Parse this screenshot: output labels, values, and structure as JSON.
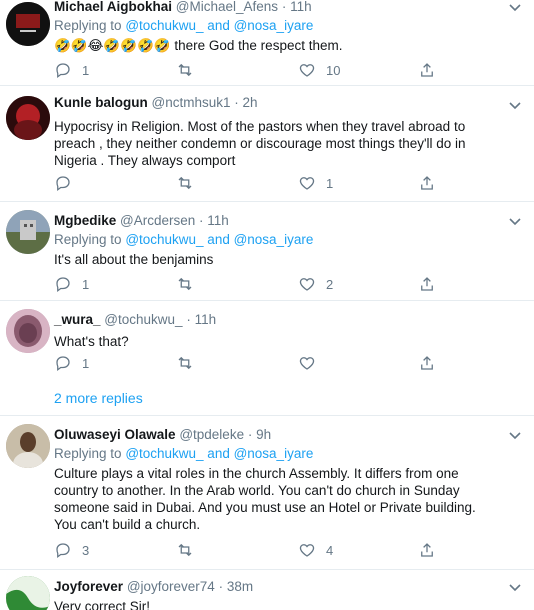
{
  "tweets": [
    {
      "name": "Michael Aigbokhai",
      "handle": "@Michael_Afens",
      "dot": "·",
      "time": "11h",
      "replying_to_prefix": "Replying to",
      "replying_to_users": "@tochukwu_ and @nosa_iyare",
      "text": "🤣🤣😂🤣🤣🤣🤣  there God the respect them.",
      "reply_count": "1",
      "like_count": "10"
    },
    {
      "name": "Kunle balogun",
      "handle": "@nctmhsuk1",
      "dot": "·",
      "time": "2h",
      "text": "Hypocrisy in Religion. Most of the pastors when they travel abroad to preach , they neither condemn or discourage most things they'll do in Nigeria . They always comport",
      "reply_count": "",
      "like_count": "1"
    },
    {
      "name": "Mgbedike",
      "handle": "@Arcdersen",
      "dot": "·",
      "time": "11h",
      "replying_to_prefix": "Replying to",
      "replying_to_users": "@tochukwu_ and @nosa_iyare",
      "text": "It's all about the benjamins",
      "reply_count": "1",
      "like_count": "2"
    },
    {
      "name": "_wura_",
      "handle": "@tochukwu_",
      "dot": "·",
      "time": "11h",
      "text": "What's that?",
      "reply_count": "1",
      "like_count": ""
    },
    {
      "name": "Oluwaseyi Olawale",
      "handle": "@tpdeleke",
      "dot": "·",
      "time": "9h",
      "replying_to_prefix": "Replying to",
      "replying_to_users": "@tochukwu_ and @nosa_iyare",
      "text": "Culture plays a vital roles in the church Assembly. It differs from one country to another. In the Arab world. You can't do church in Sunday someone said in Dubai. And you must use an Hotel or Private building. You can't build a church.",
      "reply_count": "3",
      "like_count": "4"
    },
    {
      "name": "Joyforever",
      "handle": "@joyforever74",
      "dot": "·",
      "time": "38m",
      "text": "Very correct Sir!"
    }
  ],
  "more_replies": "2 more replies",
  "icons": {
    "reply": "reply-icon",
    "retweet": "retweet-icon",
    "like": "heart-icon",
    "share": "share-icon",
    "caret": "chevron-down-icon"
  },
  "colors": {
    "link": "#1da1f2",
    "muted": "#657786",
    "text": "#14171a",
    "divider": "#e6ecf0"
  }
}
